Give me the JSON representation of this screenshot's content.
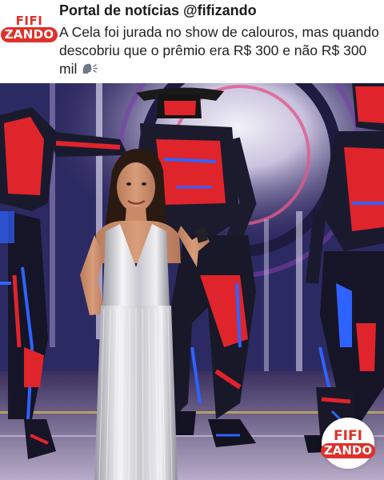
{
  "post": {
    "avatar": {
      "line1": "FIFI",
      "line2": "ZANDO"
    },
    "account_name": "Portal de notícias @fifizando",
    "text": "A Cela foi jurada no show de calouros, mas quando descobriu que o prêmio era R$ 300 e não R$ 300 mil",
    "emoji_icon": "speaking-head-icon"
  },
  "photo": {
    "watermark": {
      "line1": "FIFI",
      "line2": "ZANDO"
    }
  },
  "colors": {
    "brand_red": "#e0302a",
    "text_dark": "#1b1b1b",
    "neon_red": "#e0242c",
    "neon_blue": "#2f63ff"
  }
}
